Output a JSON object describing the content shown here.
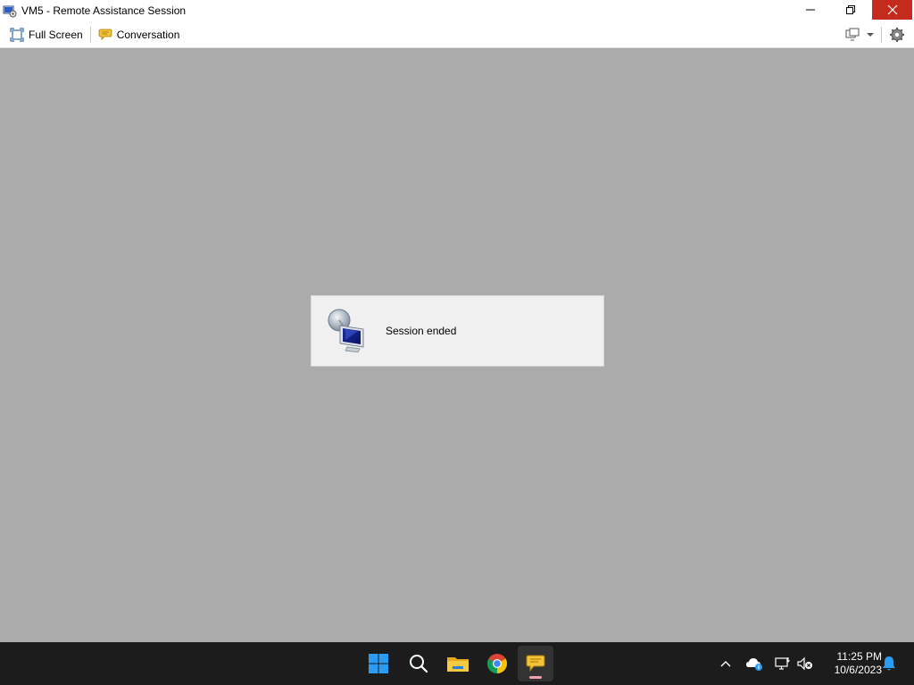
{
  "window": {
    "title": "VM5 - Remote Assistance Session",
    "close_color": "#c42b1c"
  },
  "toolbar": {
    "fullscreen_label": "Full Screen",
    "conversation_label": "Conversation"
  },
  "dialog": {
    "message": "Session ended"
  },
  "taskbar": {
    "apps": [
      "start-icon",
      "search-icon",
      "file-explorer-icon",
      "chrome-icon",
      "remote-assistance-icon"
    ],
    "active_app": "remote-assistance-icon"
  },
  "tray": {
    "time": "11:25 PM",
    "date": "10/6/2023"
  },
  "colors": {
    "canvas": "#ababab",
    "taskbar": "#1c1c1c"
  }
}
